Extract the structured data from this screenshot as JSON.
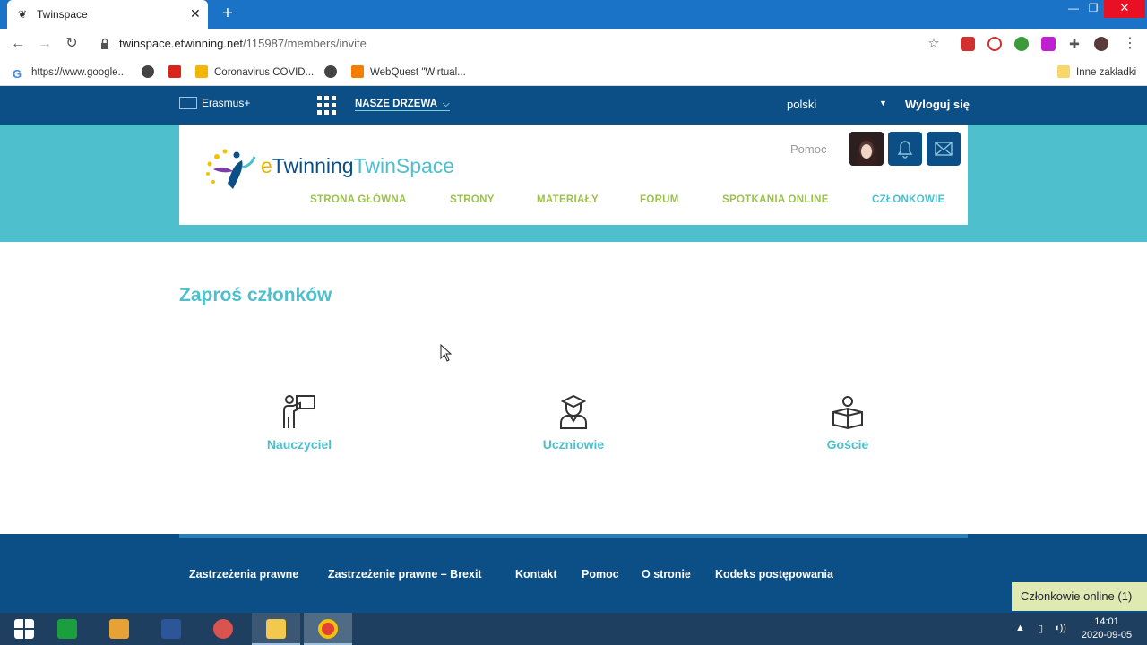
{
  "browser": {
    "tab_title": "Twinspace",
    "new_tab_glyph": "+",
    "url_host": "twinspace.etwinning.net",
    "url_path": "/115987/members/invite",
    "bookmarks": [
      {
        "label": "https://www.google...",
        "icon": "google-icon"
      },
      {
        "label": "",
        "icon": "globe-icon"
      },
      {
        "label": "",
        "icon": "flash-icon"
      },
      {
        "label": "Coronavirus COVID...",
        "icon": "site-icon"
      },
      {
        "label": "",
        "icon": "globe-icon"
      },
      {
        "label": "WebQuest \"Wirtual...",
        "icon": "blogger-icon"
      }
    ],
    "other_bookmarks": "Inne zakładki"
  },
  "topnav": {
    "erasmus": "Erasmus+",
    "trees": "NASZE DRZEWA",
    "language": "polski",
    "logout": "Wyloguj się"
  },
  "header": {
    "logo_e": "e",
    "logo_twinning": "Twinning",
    "logo_twinspace": "TwinSpace",
    "help": "Pomoc",
    "nav": [
      {
        "label": "STRONA GŁÓWNA",
        "active": false
      },
      {
        "label": "STRONY",
        "active": false
      },
      {
        "label": "MATERIAŁY",
        "active": false
      },
      {
        "label": "FORUM",
        "active": false
      },
      {
        "label": "SPOTKANIA ONLINE",
        "active": false
      },
      {
        "label": "CZŁONKOWIE",
        "active": true
      }
    ]
  },
  "main": {
    "title": "Zaproś członków",
    "roles": [
      {
        "label": "Nauczyciel",
        "icon": "teacher-icon"
      },
      {
        "label": "Uczniowie",
        "icon": "student-icon"
      },
      {
        "label": "Goście",
        "icon": "guest-icon"
      }
    ]
  },
  "footer": {
    "links": [
      "Zastrzeżenia prawne",
      "Zastrzeżenie prawne – Brexit",
      "Kontakt",
      "Pomoc",
      "O stronie",
      "Kodeks postępowania"
    ],
    "online_badge": "Członkowie online (1)"
  },
  "taskbar": {
    "time": "14:01",
    "date": "2020-09-05"
  },
  "colors": {
    "navy": "#0b4f86",
    "teal": "#4ebfcc",
    "green": "#9cc24d",
    "chrome_blue": "#1a73c7"
  }
}
